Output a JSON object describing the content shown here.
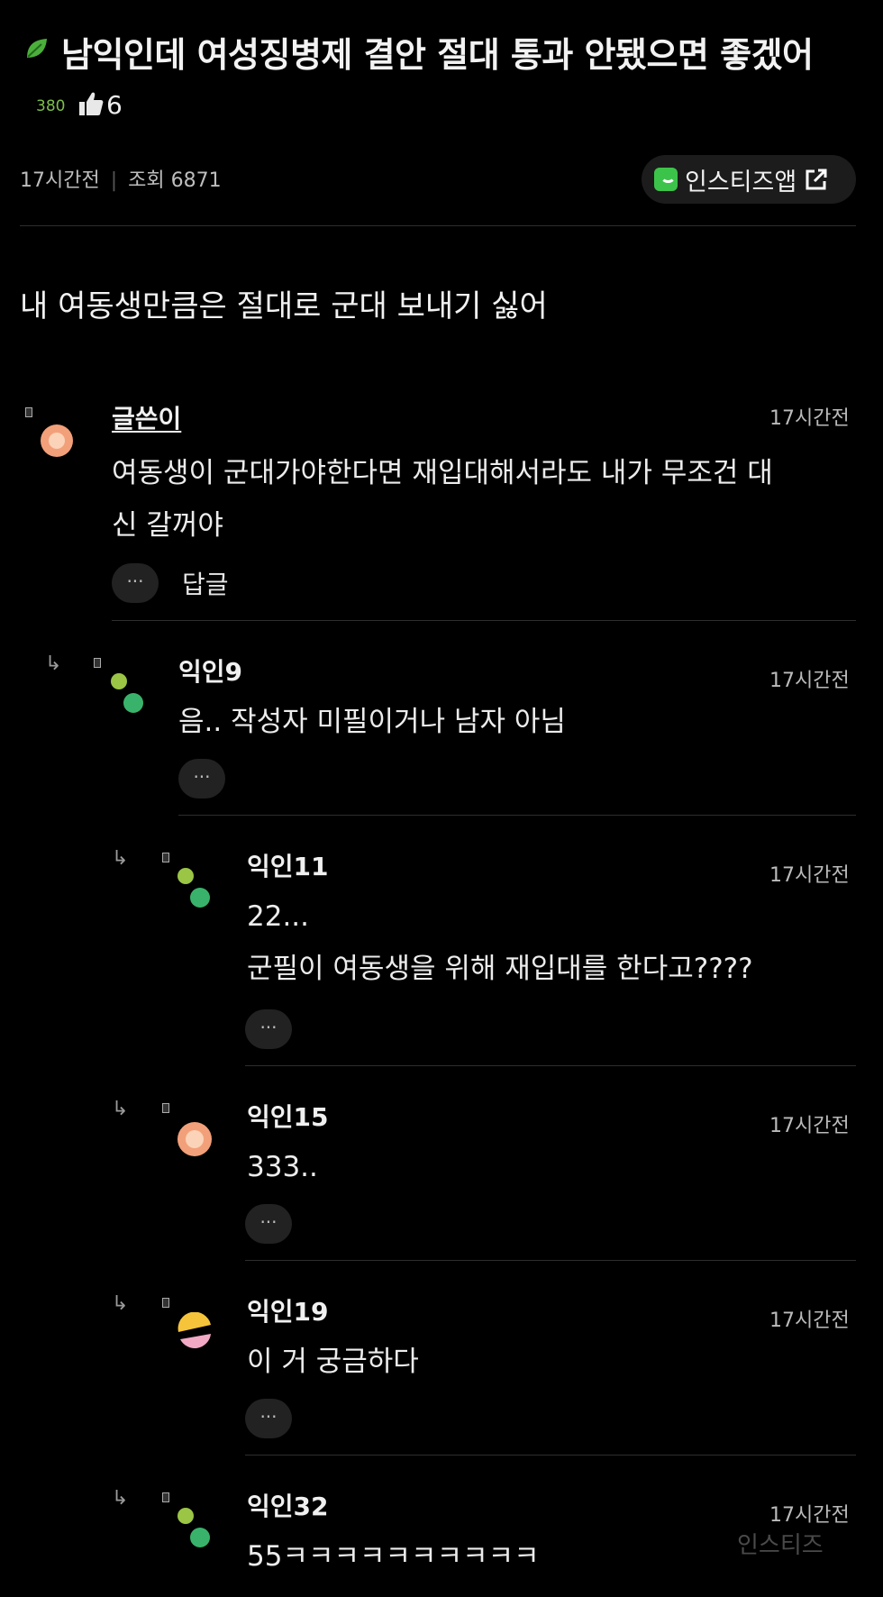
{
  "post": {
    "title": "남익인데 여성징병제 결안 절대 통과 안됐으면 좋겠어",
    "points": "380",
    "likes": "6",
    "time": "17시간전",
    "views": "조회 6871",
    "app_button": "인스티즈앱",
    "body": "내 여동생만큼은 절대로 군대 보내기 싫어"
  },
  "comments": [
    {
      "author": "글쓴이",
      "time": "17시간전",
      "lines": [
        "여동생이 군대가야한다면 재입대해서라도 내가 무조건 대",
        "신 갈꺼야"
      ],
      "reply_label": "답글"
    },
    {
      "author": "익인9",
      "time": "17시간전",
      "lines": [
        "음.. 작성자 미필이거나 남자 아님"
      ]
    },
    {
      "author": "익인11",
      "time": "17시간전",
      "lines": [
        "22...",
        "군필이 여동생을 위해 재입대를 한다고????"
      ]
    },
    {
      "author": "익인15",
      "time": "17시간전",
      "lines": [
        "333.."
      ]
    },
    {
      "author": "익인19",
      "time": "17시간전",
      "lines": [
        "이 거 궁금하다"
      ]
    },
    {
      "author": "익인32",
      "time": "17시간전",
      "lines": [
        "55ㅋㅋㅋㅋㅋㅋㅋㅋㅋㅋ"
      ]
    }
  ],
  "more_label": "···",
  "watermark": "인스티즈",
  "icons": {
    "leaf": "leaf-icon",
    "thumb": "thumbs-up-icon",
    "app": "instiz-app-icon",
    "external": "external-link-icon",
    "reply": "reply-arrow-icon"
  },
  "colors": {
    "background": "#000000",
    "accent_green": "#3cc44a",
    "points_green": "#7cbf4a"
  }
}
